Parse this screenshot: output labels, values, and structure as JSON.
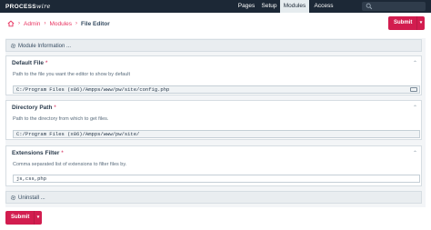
{
  "app": {
    "logo_bold": "PROCESS",
    "logo_italic": "wire"
  },
  "nav": {
    "items": [
      {
        "label": "Pages",
        "active": false
      },
      {
        "label": "Setup",
        "active": false
      },
      {
        "label": "Modules",
        "active": true
      },
      {
        "label": "Access",
        "active": false
      }
    ],
    "search_icon": "search-icon"
  },
  "breadcrumb": {
    "home_icon": "home-icon",
    "items": [
      "Admin",
      "Modules"
    ],
    "current": "File Editor",
    "separator": "›"
  },
  "actions": {
    "submit_label": "Submit",
    "caret": "▾"
  },
  "sections": {
    "module_info": "Module Information ...",
    "uninstall": "Uninstall ..."
  },
  "fields": {
    "default_file": {
      "label": "Default File",
      "required_mark": "*",
      "description": "Path to the file you want the editor to show by default",
      "value": "C:/Program Files (x86)/Ampps/www/pw/site/config.php"
    },
    "directory_path": {
      "label": "Directory Path",
      "required_mark": "*",
      "description": "Path to the directory from which to get files.",
      "value": "C:/Program Files (x86)/Ampps/www/pw/site/"
    },
    "extensions_filter": {
      "label": "Extensions Filter",
      "required_mark": "*",
      "description": "Comma separated list of extensions to filter files by.",
      "value": "js,css,php"
    }
  },
  "colors": {
    "masthead": "#1c2836",
    "accent": "#d21d4f",
    "link": "#e83561"
  }
}
